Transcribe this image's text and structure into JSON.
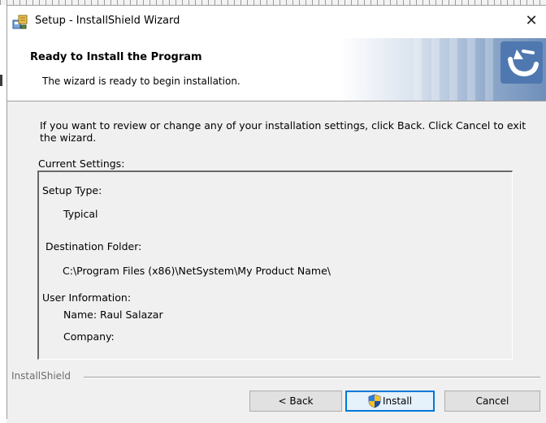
{
  "window": {
    "title": "Setup - InstallShield Wizard",
    "close_glyph": "✕"
  },
  "header": {
    "title": "Ready to Install the Program",
    "subtitle": "The wizard is ready to begin installation."
  },
  "body": {
    "description": "If you want to review or change any of your installation settings, click Back. Click Cancel to exit the wizard.",
    "current_settings_label": "Current Settings:"
  },
  "settings": {
    "setup_type_label": "Setup Type:",
    "setup_type_value": "Typical",
    "destination_label": "Destination Folder:",
    "destination_value": "C:\\Program Files (x86)\\NetSystem\\My Product Name\\",
    "user_info_label": "User Information:",
    "name_line": "Name: Raul Salazar",
    "company_line": "Company:"
  },
  "footer": {
    "brand": "InstallShield"
  },
  "buttons": {
    "back": "< Back",
    "install": "Install",
    "cancel": "Cancel"
  },
  "icons": {
    "app": "installshield-app-icon",
    "logo": "installshield-logo-icon",
    "shield": "uac-shield-icon"
  },
  "colors": {
    "install_button_border": "#0078d7",
    "header_gradient_end": "#6f8fbb"
  }
}
